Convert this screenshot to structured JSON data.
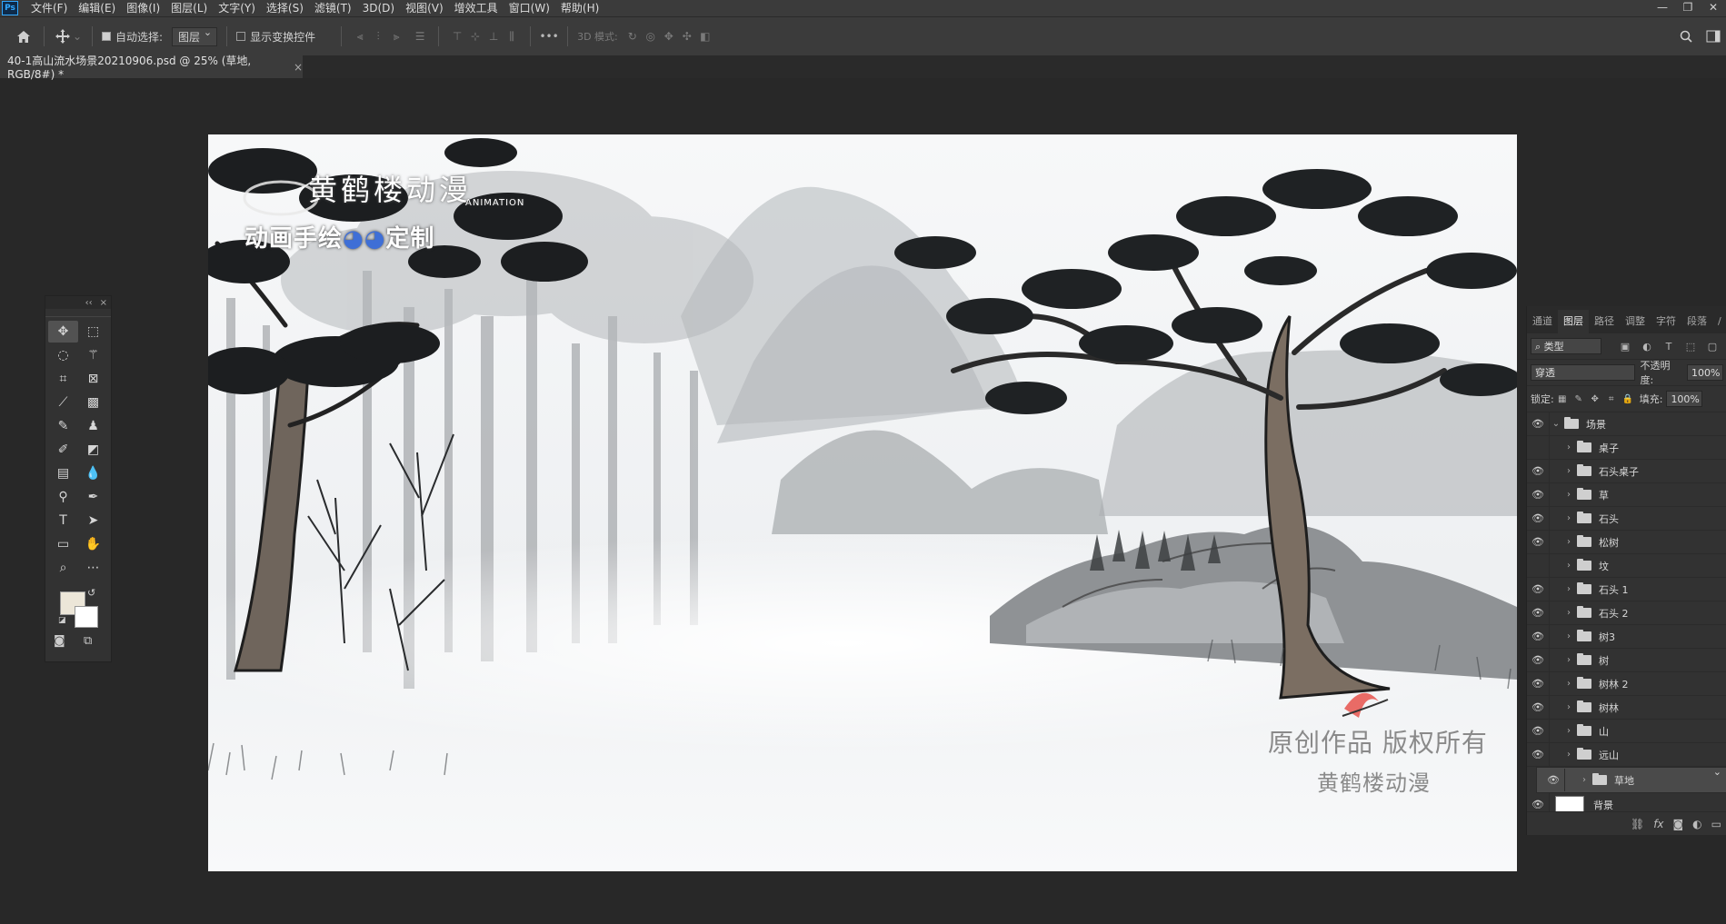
{
  "app": {
    "logo": "Ps"
  },
  "menu": [
    "文件(F)",
    "编辑(E)",
    "图像(I)",
    "图层(L)",
    "文字(Y)",
    "选择(S)",
    "滤镜(T)",
    "3D(D)",
    "视图(V)",
    "增效工具",
    "窗口(W)",
    "帮助(H)"
  ],
  "window_controls": {
    "minimize": "—",
    "restore": "❐",
    "close": "✕"
  },
  "options": {
    "auto_select_label": "自动选择:",
    "auto_select_value": "图层",
    "show_transform_label": "显示变换控件",
    "more": "•••",
    "mode3d_label": "3D 模式:"
  },
  "document": {
    "tab_title": "40-1高山流水场景20210906.psd @ 25% (草地, RGB/8#) *",
    "close": "×"
  },
  "artwork": {
    "brand_name": "黄鹤楼动漫",
    "brand_sub": "ANIMATION",
    "brand_slogan": "动画手绘",
    "brand_slogan_tail": "定制",
    "watermark_line1": "原创作品 版权所有",
    "watermark_line2": "黄鹤楼动漫"
  },
  "toolbox": {
    "collapse": "‹‹",
    "close": "×"
  },
  "panel": {
    "tabs": [
      "通道",
      "图层",
      "路径",
      "调整",
      "字符",
      "段落",
      "/"
    ],
    "active_tab": "图层",
    "filter_value": "类型",
    "blend_mode": "穿透",
    "opacity_label": "不透明度:",
    "opacity_value": "100%",
    "lock_label": "锁定:",
    "fill_label": "填充:",
    "fill_value": "100%",
    "group_name": "场景",
    "layers": [
      {
        "name": "桌子",
        "visible": false
      },
      {
        "name": "石头桌子",
        "visible": true
      },
      {
        "name": "草",
        "visible": true
      },
      {
        "name": "石头",
        "visible": true
      },
      {
        "name": "松树",
        "visible": true
      },
      {
        "name": "坟",
        "visible": false
      },
      {
        "name": "石头 1",
        "visible": true
      },
      {
        "name": "石头 2",
        "visible": true
      },
      {
        "name": "树3",
        "visible": true
      },
      {
        "name": "树",
        "visible": true
      },
      {
        "name": "树林 2",
        "visible": true
      },
      {
        "name": "树林",
        "visible": true
      },
      {
        "name": "山",
        "visible": true
      },
      {
        "name": "远山",
        "visible": true
      },
      {
        "name": "草地",
        "visible": true,
        "selected": true
      }
    ],
    "background_layer": "背景",
    "footer_fx": "fx"
  }
}
